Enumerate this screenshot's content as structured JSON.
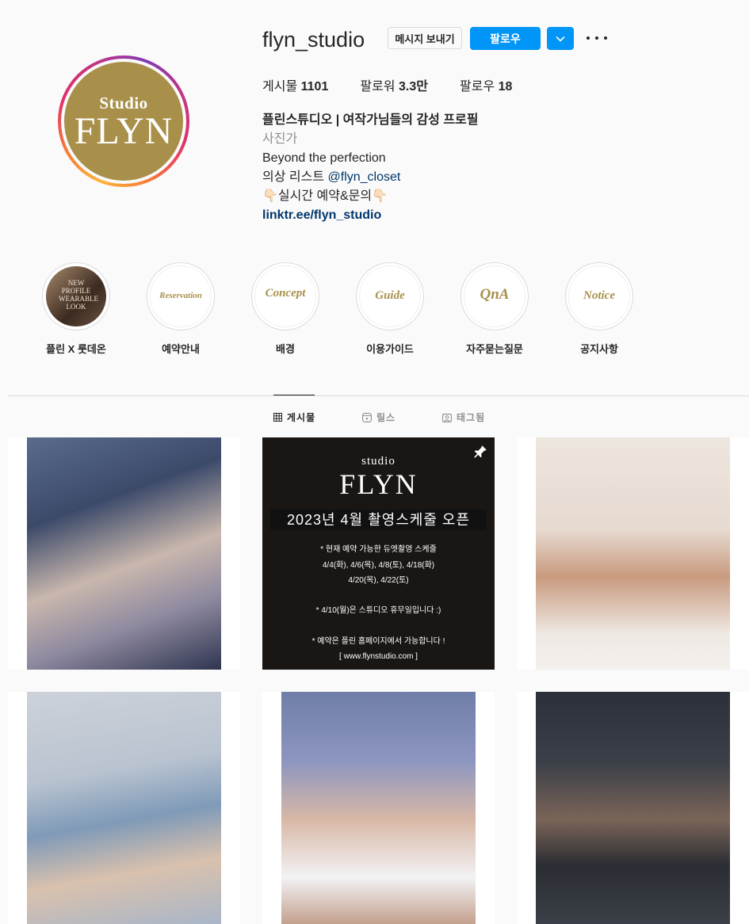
{
  "profile": {
    "username": "flyn_studio",
    "avatar_small": "Studio",
    "avatar_big": "FLYN",
    "buttons": {
      "message": "메시지 보내기",
      "follow": "팔로우"
    },
    "stats": {
      "posts_label": "게시물",
      "posts_value": "1101",
      "followers_label": "팔로워",
      "followers_value": "3.3만",
      "following_label": "팔로우",
      "following_value": "18"
    },
    "bio": {
      "name": "플린스튜디오 | 여작가님들의 감성 프로필",
      "category": "사진가",
      "line1": "Beyond the perfection",
      "line2_prefix": "의상 리스트 ",
      "line2_mention": "@flyn_closet",
      "line3": "실시간 예약&문의",
      "hand_emoji": "👇🏻",
      "url": "linktr.ee/flyn_studio"
    }
  },
  "highlights": [
    {
      "label": "플린 X 룻데온",
      "cover_text": "NEW PROFILE WEARABLE LOOK"
    },
    {
      "label": "예약안내",
      "cover_text": "Reservation"
    },
    {
      "label": "배경",
      "cover_text": "Concept"
    },
    {
      "label": "이용가이드",
      "cover_text": "Guide"
    },
    {
      "label": "자주묻는질문",
      "cover_text": "QnA"
    },
    {
      "label": "공지사항",
      "cover_text": "Notice"
    }
  ],
  "tabs": {
    "posts": "게시물",
    "reels": "릴스",
    "tagged": "태그됨"
  },
  "poster": {
    "studio": "studio",
    "flyn": "FLYN",
    "headline": "2023년 4월 촬영스케줄 오픈",
    "line1": "* 현재 예약 가능한 듀엣촬영 스케줄",
    "line2": "4/4(화), 4/6(목), 4/8(토), 4/18(화)",
    "line3": "4/20(목), 4/22(토)",
    "line4": "* 4/10(월)은 스튜디오 휴무일입니다 :)",
    "line5": "* 예약은 플린 홈페이지에서 가능합니다 !",
    "line6": "[ www.flynstudio.com ]"
  },
  "colors": {
    "accent": "#0095f6",
    "brand_gold": "#a8904a",
    "link": "#00376b"
  }
}
